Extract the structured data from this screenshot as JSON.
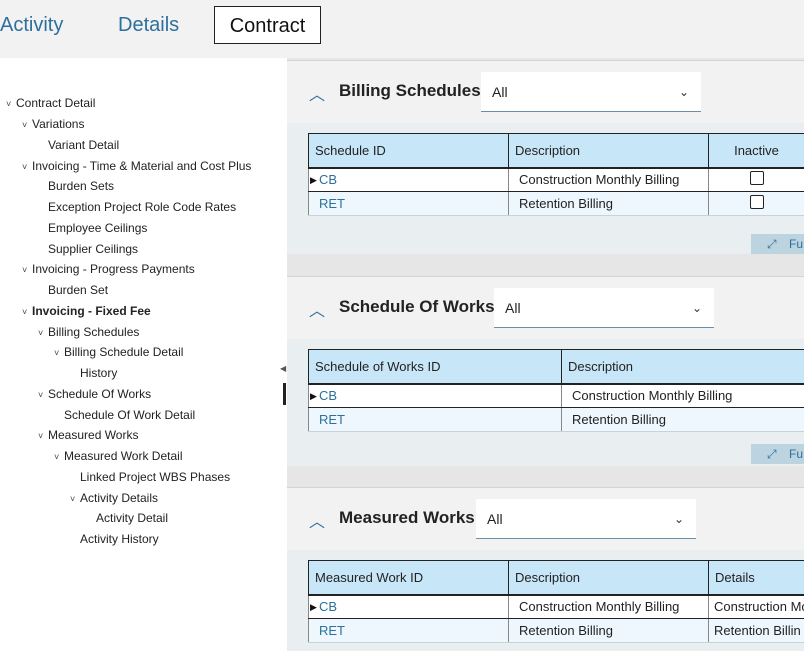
{
  "tabs": [
    "Activity",
    "Details",
    "Contract"
  ],
  "tree": [
    {
      "label": "Contract Detail",
      "chev": "˅",
      "bold": false
    },
    {
      "label": "Variations",
      "chev": "˅",
      "bold": false
    },
    {
      "label": "Variant Detail",
      "chev": "",
      "bold": false
    },
    {
      "label": "Invoicing - Time & Material and Cost Plus",
      "chev": "˅",
      "bold": false
    },
    {
      "label": "Burden Sets",
      "chev": "",
      "bold": false
    },
    {
      "label": "Exception Project Role Code Rates",
      "chev": "",
      "bold": false
    },
    {
      "label": "Employee Ceilings",
      "chev": "",
      "bold": false
    },
    {
      "label": "Supplier Ceilings",
      "chev": "",
      "bold": false
    },
    {
      "label": "Invoicing - Progress Payments",
      "chev": "˅",
      "bold": false
    },
    {
      "label": "Burden Set",
      "chev": "",
      "bold": false
    },
    {
      "label": "Invoicing - Fixed Fee",
      "chev": "˅",
      "bold": true
    },
    {
      "label": "Billing Schedules",
      "chev": "˅",
      "bold": false
    },
    {
      "label": "Billing Schedule Detail",
      "chev": "˅",
      "bold": false
    },
    {
      "label": "History",
      "chev": "",
      "bold": false
    },
    {
      "label": "Schedule Of Works",
      "chev": "˅",
      "bold": false
    },
    {
      "label": "Schedule Of Work Detail",
      "chev": "",
      "bold": false
    },
    {
      "label": "Measured Works",
      "chev": "˅",
      "bold": false
    },
    {
      "label": "Measured Work Detail",
      "chev": "˅",
      "bold": false
    },
    {
      "label": "Linked Project WBS Phases",
      "chev": "",
      "bold": false
    },
    {
      "label": "Activity Details",
      "chev": "˅",
      "bold": false
    },
    {
      "label": "Activity Detail",
      "chev": "",
      "bold": false
    },
    {
      "label": "Activity History",
      "chev": "",
      "bold": false
    }
  ],
  "sections": {
    "billing": {
      "title": "Billing Schedules",
      "filter": "All",
      "columns": [
        "Schedule ID",
        "Description",
        "Inactive"
      ],
      "rows": [
        {
          "id": "CB",
          "description": "Construction Monthly Billing"
        },
        {
          "id": "RET",
          "description": "Retention Billing"
        }
      ],
      "full_label": "Fu"
    },
    "schedule": {
      "title": "Schedule Of Works",
      "filter": "All",
      "columns": [
        "Schedule of Works ID",
        "Description"
      ],
      "rows": [
        {
          "id": "CB",
          "description": "Construction Monthly Billing"
        },
        {
          "id": "RET",
          "description": "Retention Billing"
        }
      ],
      "full_label": "Fu"
    },
    "measured": {
      "title": "Measured Works",
      "filter": "All",
      "columns": [
        "Measured Work ID",
        "Description",
        "Details"
      ],
      "rows": [
        {
          "id": "CB",
          "description": "Construction Monthly Billing",
          "details": "Construction Mo"
        },
        {
          "id": "RET",
          "description": "Retention Billing",
          "details": "Retention Billin"
        }
      ]
    }
  },
  "icons": {
    "collapse": "collapse-chevron-up-icon",
    "dropdown": "chevron-down-icon",
    "expand": "expand-arrows-icon",
    "row_pointer": "row-pointer-icon"
  }
}
